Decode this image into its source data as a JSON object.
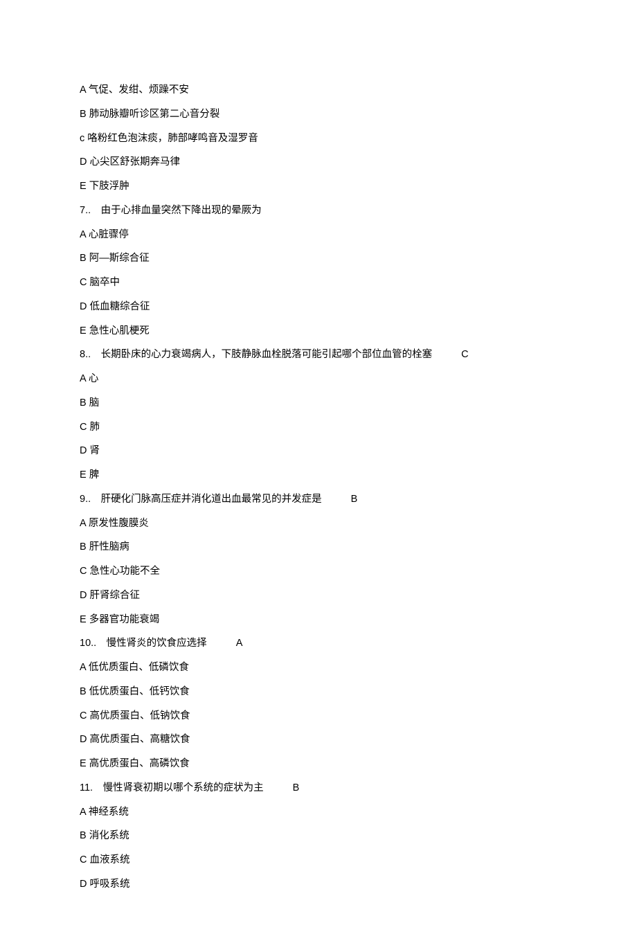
{
  "lines": [
    {
      "text": "A 气促、发绀、烦躁不安"
    },
    {
      "text": "B 肺动脉瓣听诊区第二心音分裂"
    },
    {
      "text": "c 咯粉红色泡沫痰，肺部哮鸣音及湿罗音"
    },
    {
      "text": "D 心尖区舒张期奔马律"
    },
    {
      "text": "E 下肢浮肿"
    },
    {
      "text": "7..　由于心排血量突然下降出现的晕厥为"
    },
    {
      "text": "A 心脏骤停"
    },
    {
      "text": "B 阿—斯综合征"
    },
    {
      "text": "C 脑卒中"
    },
    {
      "text": "D 低血糖综合征"
    },
    {
      "text": "E 急性心肌梗死"
    },
    {
      "text": "8..　长期卧床的心力衰竭病人，下肢静脉血栓脱落可能引起哪个部位血管的栓塞",
      "answer": "C"
    },
    {
      "text": "A 心"
    },
    {
      "text": "B 脑"
    },
    {
      "text": "C 肺"
    },
    {
      "text": "D 肾"
    },
    {
      "text": "E 脾"
    },
    {
      "text": "9..　肝硬化门脉高压症并消化道出血最常见的并发症是",
      "answer": "B"
    },
    {
      "text": "A 原发性腹膜炎"
    },
    {
      "text": "B 肝性脑病"
    },
    {
      "text": "C 急性心功能不全"
    },
    {
      "text": "D 肝肾综合征"
    },
    {
      "text": "E 多器官功能衰竭"
    },
    {
      "text": "10..　慢性肾炎的饮食应选择",
      "answer": "A"
    },
    {
      "text": "A 低优质蛋白、低磷饮食"
    },
    {
      "text": "B 低优质蛋白、低钙饮食"
    },
    {
      "text": "C 高优质蛋白、低钠饮食"
    },
    {
      "text": "D 高优质蛋白、高糖饮食"
    },
    {
      "text": "E 高优质蛋白、高磷饮食"
    },
    {
      "text": "11.　慢性肾衰初期以哪个系统的症状为主",
      "answer": "B"
    },
    {
      "text": "A 神经系统"
    },
    {
      "text": "B 消化系统"
    },
    {
      "text": "C 血液系统"
    },
    {
      "text": "D 呼吸系统"
    }
  ]
}
